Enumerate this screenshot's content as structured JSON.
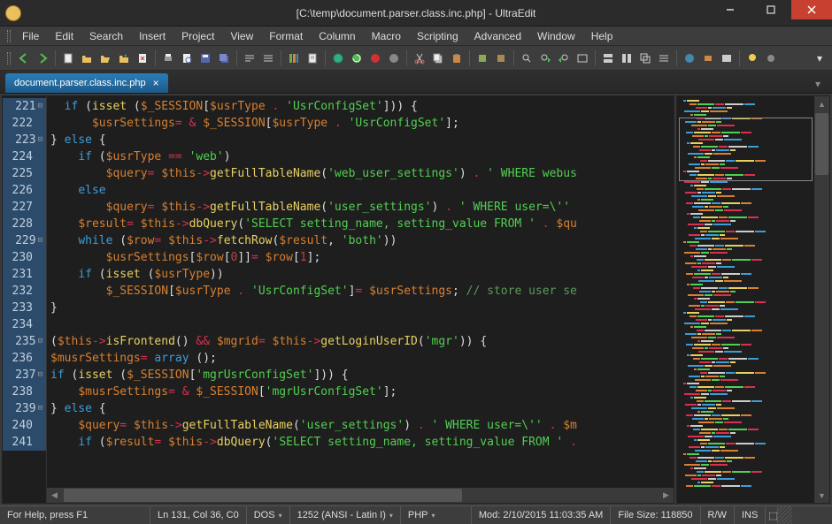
{
  "window": {
    "title": "[C:\\temp\\document.parser.class.inc.php] - UltraEdit"
  },
  "menu": [
    "File",
    "Edit",
    "Search",
    "Insert",
    "Project",
    "View",
    "Format",
    "Column",
    "Macro",
    "Scripting",
    "Advanced",
    "Window",
    "Help"
  ],
  "tab": {
    "label": "document.parser.class.inc.php"
  },
  "lines": {
    "start": 221,
    "end": 241,
    "foldable": [
      221,
      223,
      229,
      235,
      237,
      239
    ]
  },
  "code": [
    [
      [
        "  ",
        ""
      ],
      [
        "if",
        "kw"
      ],
      [
        " (",
        ""
      ],
      [
        "isset",
        "fn"
      ],
      [
        " (",
        ""
      ],
      [
        "$_SESSION",
        "var"
      ],
      [
        "[",
        ""
      ],
      [
        "$usrType",
        "var"
      ],
      [
        " ",
        ""
      ],
      [
        ". ",
        "op"
      ],
      [
        "'UsrConfigSet'",
        "str"
      ],
      [
        "])) {",
        ""
      ]
    ],
    [
      [
        "      ",
        ""
      ],
      [
        "$usrSettings",
        "var"
      ],
      [
        "= ",
        "op"
      ],
      [
        "& ",
        "op"
      ],
      [
        "$_SESSION",
        "var"
      ],
      [
        "[",
        ""
      ],
      [
        "$usrType",
        "var"
      ],
      [
        " ",
        ""
      ],
      [
        ". ",
        "op"
      ],
      [
        "'UsrConfigSet'",
        "str"
      ],
      [
        "];",
        ""
      ]
    ],
    [
      [
        "} ",
        ""
      ],
      [
        "else",
        "kw"
      ],
      [
        " {",
        ""
      ]
    ],
    [
      [
        "    ",
        ""
      ],
      [
        "if",
        "kw"
      ],
      [
        " (",
        ""
      ],
      [
        "$usrType",
        "var"
      ],
      [
        " ",
        ""
      ],
      [
        "== ",
        "op"
      ],
      [
        "'web'",
        "str"
      ],
      [
        ")",
        ""
      ]
    ],
    [
      [
        "        ",
        ""
      ],
      [
        "$query",
        "var"
      ],
      [
        "= ",
        "op"
      ],
      [
        "$this",
        "this"
      ],
      [
        "->",
        "op"
      ],
      [
        "getFullTableName",
        "fn"
      ],
      [
        "(",
        ""
      ],
      [
        "'web_user_settings'",
        "str"
      ],
      [
        ") ",
        ""
      ],
      [
        ". ",
        "op"
      ],
      [
        "' WHERE webus",
        "str"
      ]
    ],
    [
      [
        "    ",
        ""
      ],
      [
        "else",
        "kw"
      ]
    ],
    [
      [
        "        ",
        ""
      ],
      [
        "$query",
        "var"
      ],
      [
        "= ",
        "op"
      ],
      [
        "$this",
        "this"
      ],
      [
        "->",
        "op"
      ],
      [
        "getFullTableName",
        "fn"
      ],
      [
        "(",
        ""
      ],
      [
        "'user_settings'",
        "str"
      ],
      [
        ") ",
        ""
      ],
      [
        ". ",
        "op"
      ],
      [
        "' WHERE user=\\''",
        "str"
      ]
    ],
    [
      [
        "    ",
        ""
      ],
      [
        "$result",
        "var"
      ],
      [
        "= ",
        "op"
      ],
      [
        "$this",
        "this"
      ],
      [
        "->",
        "op"
      ],
      [
        "dbQuery",
        "fn"
      ],
      [
        "(",
        ""
      ],
      [
        "'SELECT setting_name, setting_value FROM '",
        "str"
      ],
      [
        " ",
        ""
      ],
      [
        ". ",
        "op"
      ],
      [
        "$qu",
        "var"
      ]
    ],
    [
      [
        "    ",
        ""
      ],
      [
        "while",
        "kw"
      ],
      [
        " (",
        ""
      ],
      [
        "$row",
        "var"
      ],
      [
        "= ",
        "op"
      ],
      [
        "$this",
        "this"
      ],
      [
        "->",
        "op"
      ],
      [
        "fetchRow",
        "fn"
      ],
      [
        "(",
        ""
      ],
      [
        "$result",
        "var"
      ],
      [
        ", ",
        ""
      ],
      [
        "'both'",
        "str"
      ],
      [
        "))",
        ""
      ]
    ],
    [
      [
        "        ",
        ""
      ],
      [
        "$usrSettings",
        "var"
      ],
      [
        "[",
        ""
      ],
      [
        "$row",
        "var"
      ],
      [
        "[",
        ""
      ],
      [
        "0",
        "num"
      ],
      [
        "]]",
        ""
      ],
      [
        "= ",
        "op"
      ],
      [
        "$row",
        "var"
      ],
      [
        "[",
        ""
      ],
      [
        "1",
        "num"
      ],
      [
        "];",
        ""
      ]
    ],
    [
      [
        "    ",
        ""
      ],
      [
        "if",
        "kw"
      ],
      [
        " (",
        ""
      ],
      [
        "isset",
        "fn"
      ],
      [
        " (",
        ""
      ],
      [
        "$usrType",
        "var"
      ],
      [
        "))",
        ""
      ]
    ],
    [
      [
        "        ",
        ""
      ],
      [
        "$_SESSION",
        "var"
      ],
      [
        "[",
        ""
      ],
      [
        "$usrType",
        "var"
      ],
      [
        " ",
        ""
      ],
      [
        ". ",
        "op"
      ],
      [
        "'UsrConfigSet'",
        "str"
      ],
      [
        "]",
        ""
      ],
      [
        "= ",
        "op"
      ],
      [
        "$usrSettings",
        "var"
      ],
      [
        "; ",
        ""
      ],
      [
        "// store user se",
        "cmt"
      ]
    ],
    [
      [
        "}",
        ""
      ]
    ],
    [
      [
        "",
        ""
      ]
    ],
    [
      [
        "(",
        ""
      ],
      [
        "$this",
        "this"
      ],
      [
        "->",
        "op"
      ],
      [
        "isFrontend",
        "fn"
      ],
      [
        "() ",
        ""
      ],
      [
        "&& ",
        "op"
      ],
      [
        "$mgrid",
        "var"
      ],
      [
        "= ",
        "op"
      ],
      [
        "$this",
        "this"
      ],
      [
        "->",
        "op"
      ],
      [
        "getLoginUserID",
        "fn"
      ],
      [
        "(",
        ""
      ],
      [
        "'mgr'",
        "str"
      ],
      [
        ")) {",
        ""
      ]
    ],
    [
      [
        "$musrSettings",
        "var"
      ],
      [
        "= ",
        "op"
      ],
      [
        "array",
        "kw"
      ],
      [
        " ();",
        ""
      ]
    ],
    [
      [
        "if",
        "kw"
      ],
      [
        " (",
        ""
      ],
      [
        "isset",
        "fn"
      ],
      [
        " (",
        ""
      ],
      [
        "$_SESSION",
        "var"
      ],
      [
        "[",
        ""
      ],
      [
        "'mgrUsrConfigSet'",
        "str"
      ],
      [
        "])) {",
        ""
      ]
    ],
    [
      [
        "    ",
        ""
      ],
      [
        "$musrSettings",
        "var"
      ],
      [
        "= ",
        "op"
      ],
      [
        "& ",
        "op"
      ],
      [
        "$_SESSION",
        "var"
      ],
      [
        "[",
        ""
      ],
      [
        "'mgrUsrConfigSet'",
        "str"
      ],
      [
        "];",
        ""
      ]
    ],
    [
      [
        "} ",
        ""
      ],
      [
        "else",
        "kw"
      ],
      [
        " {",
        ""
      ]
    ],
    [
      [
        "    ",
        ""
      ],
      [
        "$query",
        "var"
      ],
      [
        "= ",
        "op"
      ],
      [
        "$this",
        "this"
      ],
      [
        "->",
        "op"
      ],
      [
        "getFullTableName",
        "fn"
      ],
      [
        "(",
        ""
      ],
      [
        "'user_settings'",
        "str"
      ],
      [
        ") ",
        ""
      ],
      [
        ". ",
        "op"
      ],
      [
        "' WHERE user=\\''",
        "str"
      ],
      [
        " ",
        ""
      ],
      [
        ". ",
        "op"
      ],
      [
        "$m",
        "var"
      ]
    ],
    [
      [
        "    ",
        ""
      ],
      [
        "if",
        "kw"
      ],
      [
        " (",
        ""
      ],
      [
        "$result",
        "var"
      ],
      [
        "= ",
        "op"
      ],
      [
        "$this",
        "this"
      ],
      [
        "->",
        "op"
      ],
      [
        "dbQuery",
        "fn"
      ],
      [
        "(",
        ""
      ],
      [
        "'SELECT setting_name, setting_value FROM '",
        "str"
      ],
      [
        " ",
        ""
      ],
      [
        ". ",
        "op"
      ]
    ]
  ],
  "status": {
    "help": "For Help, press F1",
    "pos": "Ln 131, Col 36, C0",
    "lineend": "DOS",
    "encoding": "1252  (ANSI - Latin I)",
    "lang": "PHP",
    "mod": "Mod: 2/10/2015 11:03:35 AM",
    "size": "File Size: 118850",
    "rw": "R/W",
    "ins": "INS"
  }
}
